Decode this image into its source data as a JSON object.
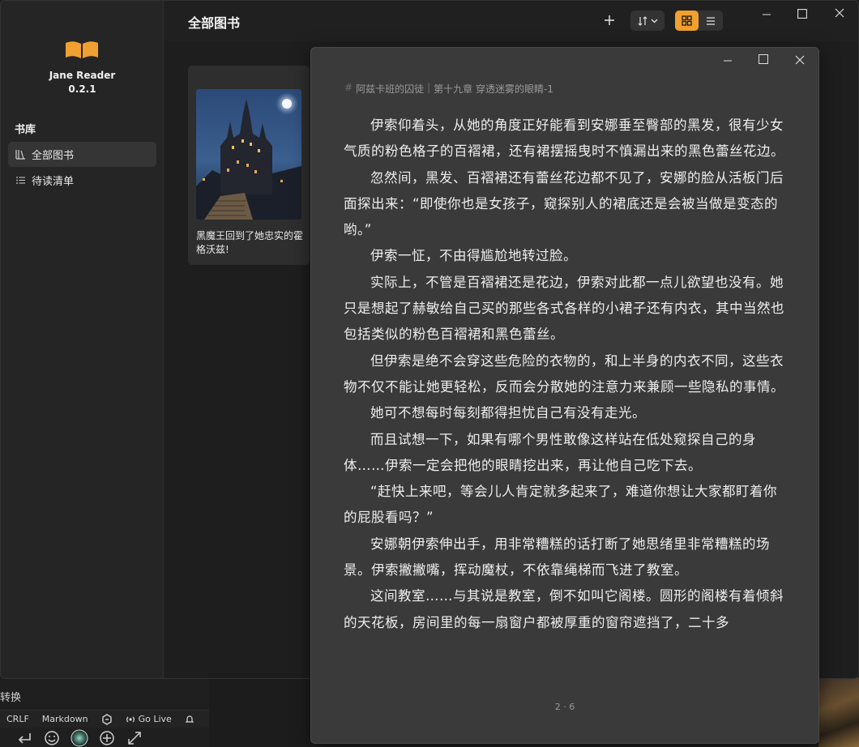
{
  "app": {
    "name": "Jane Reader",
    "version": "0.2.1"
  },
  "sidebar": {
    "library_header": "书库",
    "items": [
      {
        "label": "全部图书",
        "icon": "library-icon",
        "active": true
      },
      {
        "label": "待读清单",
        "icon": "list-icon",
        "active": false
      }
    ]
  },
  "toolbar": {
    "title": "全部图书",
    "add_icon": "plus-icon",
    "sort_icon": "sort-icon",
    "view_modes": [
      "grid",
      "list"
    ],
    "active_view": "grid",
    "accent_color": "#f0a030"
  },
  "books": [
    {
      "title": "黑魔王回到了她忠实的霍格沃兹!"
    }
  ],
  "reader": {
    "book_title": "阿兹卡班的囚徒",
    "chapter": "第十九章 穿透迷雾的眼睛-1",
    "paragraphs": [
      "伊索仰着头，从她的角度正好能看到安娜垂至臀部的黑发，很有少女气质的粉色格子的百褶裙，还有裙摆摇曳时不慎漏出来的黑色蕾丝花边。",
      "忽然间，黑发、百褶裙还有蕾丝花边都不见了，安娜的脸从活板门后面探出来：“即使你也是女孩子，窥探别人的裙底还是会被当做是变态的哟。”",
      "伊索一怔，不由得尴尬地转过脸。",
      "实际上，不管是百褶裙还是花边，伊索对此都一点儿欲望也没有。她只是想起了赫敏给自己买的那些各式各样的小裙子还有内衣，其中当然也包括类似的粉色百褶裙和黑色蕾丝。",
      "但伊索是绝不会穿这些危险的衣物的，和上半身的内衣不同，这些衣物不仅不能让她更轻松，反而会分散她的注意力来兼顾一些隐私的事情。",
      "她可不想每时每刻都得担忧自己有没有走光。",
      "而且试想一下，如果有哪个男性敢像这样站在低处窥探自己的身体……伊索一定会把他的眼睛挖出来，再让他自己吃下去。",
      "“赶快上来吧，等会儿人肯定就多起来了，难道你想让大家都盯着你的屁股看吗？”",
      "安娜朝伊索伸出手，用非常糟糕的话打断了她思绪里非常糟糕的场景。伊索撇撇嘴，挥动魔杖，不依靠绳梯而飞进了教室。",
      "这间教室……与其说是教室，倒不如叫它阁楼。圆形的阁楼有着倾斜的天花板，房间里的每一扇窗户都被厚重的窗帘遮挡了，二十多"
    ],
    "page_indicator": "2 · 6"
  },
  "background": {
    "convert_label": "转换",
    "status_items": [
      "CRLF",
      "Markdown",
      "Go Live"
    ],
    "bottom_icons": [
      "return-icon",
      "smiley-icon",
      "orb-icon",
      "plus-circle-icon",
      "expand-icon"
    ]
  }
}
